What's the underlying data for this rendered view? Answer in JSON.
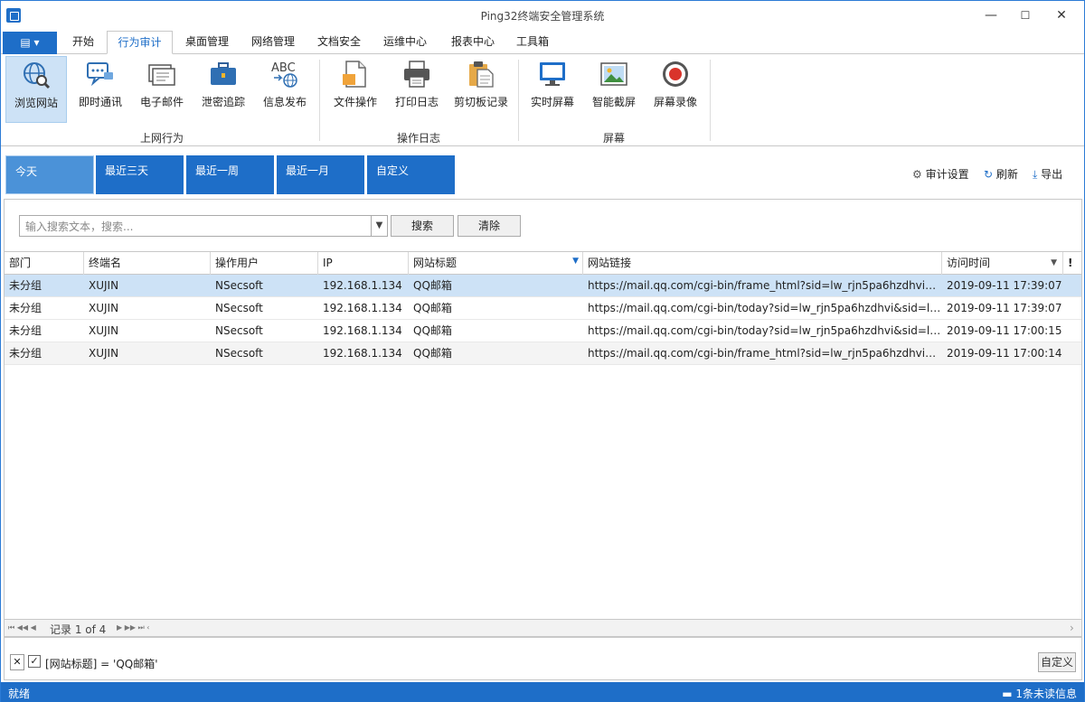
{
  "window": {
    "title": "Ping32终端安全管理系统",
    "min": "—",
    "max": "☐",
    "close": "✕"
  },
  "file_menu": "▤ ▾",
  "tabs": [
    {
      "label": "开始"
    },
    {
      "label": "行为审计"
    },
    {
      "label": "桌面管理"
    },
    {
      "label": "网络管理"
    },
    {
      "label": "文档安全"
    },
    {
      "label": "运维中心"
    },
    {
      "label": "报表中心"
    },
    {
      "label": "工具箱"
    }
  ],
  "ribbon": {
    "buttons": [
      {
        "label": "浏览网站",
        "icon": "globe-search-icon"
      },
      {
        "label": "即时通讯",
        "icon": "chat-icon"
      },
      {
        "label": "电子邮件",
        "icon": "email-icon"
      },
      {
        "label": "泄密追踪",
        "icon": "briefcase-icon"
      },
      {
        "label": "信息发布",
        "icon": "abc-globe-icon"
      },
      {
        "label": "文件操作",
        "icon": "file-icon"
      },
      {
        "label": "打印日志",
        "icon": "printer-icon"
      },
      {
        "label": "剪切板记录",
        "icon": "clipboard-icon"
      },
      {
        "label": "实时屏幕",
        "icon": "monitor-icon"
      },
      {
        "label": "智能截屏",
        "icon": "image-icon"
      },
      {
        "label": "屏幕录像",
        "icon": "record-icon"
      }
    ],
    "groups": [
      {
        "label": "上网行为"
      },
      {
        "label": "操作日志"
      },
      {
        "label": "屏幕"
      }
    ]
  },
  "filters": [
    {
      "label": "今天"
    },
    {
      "label": "最近三天"
    },
    {
      "label": "最近一周"
    },
    {
      "label": "最近一月"
    },
    {
      "label": "自定义"
    }
  ],
  "actions": {
    "settings": "审计设置",
    "refresh": "刷新",
    "export": "导出"
  },
  "search": {
    "placeholder": "输入搜索文本，搜索...",
    "search_btn": "搜索",
    "clear_btn": "清除"
  },
  "grid": {
    "columns": [
      "部门",
      "终端名",
      "操作用户",
      "IP",
      "网站标题",
      "网站链接",
      "访问时间",
      "!"
    ],
    "rows": [
      [
        "未分组",
        "XUJIN",
        "NSecsoft",
        "192.168.1.134",
        "QQ邮箱",
        "https://mail.qq.com/cgi-bin/frame_html?sid=lw_rjn5pa6hzdhvi&r...",
        "2019-09-11 17:39:07"
      ],
      [
        "未分组",
        "XUJIN",
        "NSecsoft",
        "192.168.1.134",
        "QQ邮箱",
        "https://mail.qq.com/cgi-bin/today?sid=lw_rjn5pa6hzdhvi&sid=lw...",
        "2019-09-11 17:39:07"
      ],
      [
        "未分组",
        "XUJIN",
        "NSecsoft",
        "192.168.1.134",
        "QQ邮箱",
        "https://mail.qq.com/cgi-bin/today?sid=lw_rjn5pa6hzdhvi&sid=lw...",
        "2019-09-11 17:00:15"
      ],
      [
        "未分组",
        "XUJIN",
        "NSecsoft",
        "192.168.1.134",
        "QQ邮箱",
        "https://mail.qq.com/cgi-bin/frame_html?sid=lw_rjn5pa6hzdhvi&r...",
        "2019-09-11 17:00:14"
      ]
    ]
  },
  "pager": {
    "nav_left": "⏮ ◀◀ ◀",
    "text": "记录 1 of 4",
    "nav_right": "▶ ▶▶ ⏭ ‹",
    "scroll_right": "›"
  },
  "filterbar": {
    "close": "✕",
    "check": "✓",
    "expr": "[网站标题] = 'QQ邮箱'",
    "custom": "自定义"
  },
  "status": {
    "left": "就绪",
    "right": "1条未读信息"
  },
  "colors": {
    "accent": "#1e6ec8",
    "selected_row": "#cde2f6"
  }
}
